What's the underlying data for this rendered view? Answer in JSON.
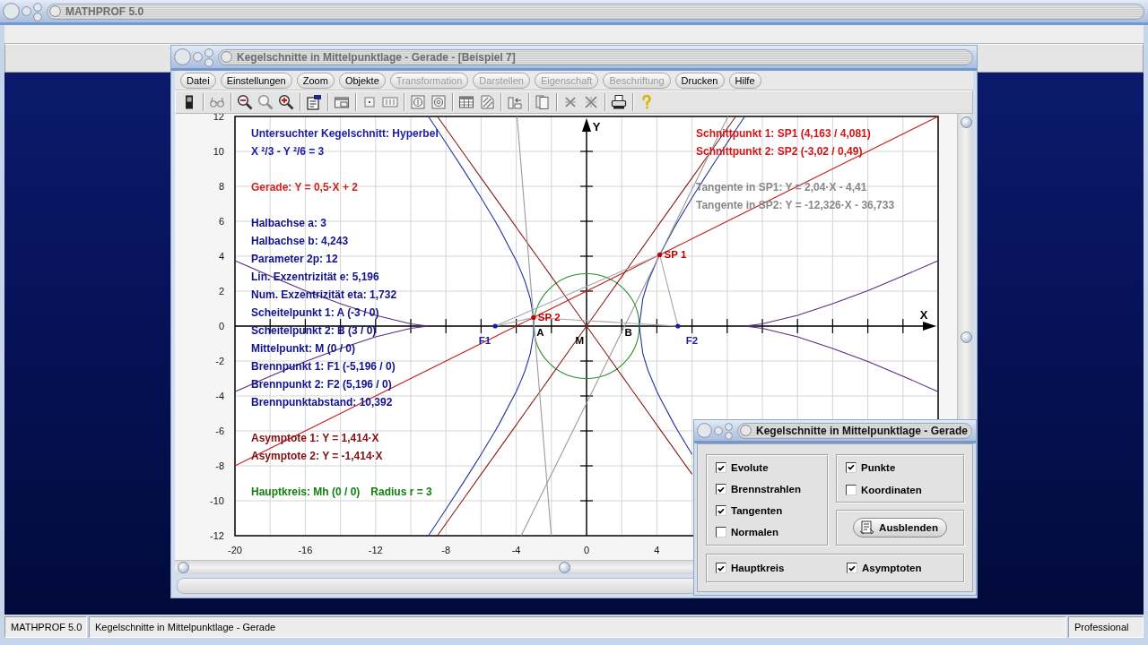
{
  "main_window": {
    "title": "MATHPROF 5.0"
  },
  "document_window": {
    "title": "Kegelschnitte in Mittelpunktlage - Gerade - [Beispiel 7]",
    "menu": [
      {
        "label": "Datei",
        "disabled": false
      },
      {
        "label": "Einstellungen",
        "disabled": false
      },
      {
        "label": "Zoom",
        "disabled": false
      },
      {
        "label": "Objekte",
        "disabled": false
      },
      {
        "label": "Transformation",
        "disabled": true
      },
      {
        "label": "Darstellen",
        "disabled": true
      },
      {
        "label": "Eigenschaft",
        "disabled": true
      },
      {
        "label": "Beschriftung",
        "disabled": true
      },
      {
        "label": "Drucken",
        "disabled": false
      },
      {
        "label": "Hilfe",
        "disabled": false
      }
    ],
    "plot": {
      "info_left": [
        {
          "kind": "column",
          "color": "#1a1aa6",
          "lines": [
            "Untersuchter Kegelschnitt: Hyperbel",
            "X ²/3 - Y ²/6 = 3"
          ]
        },
        {
          "kind": "column",
          "color": "#d42020",
          "lines": [
            "Gerade: Y = 0,5·X + 2"
          ]
        },
        {
          "kind": "column",
          "color": "#12128c",
          "lines": [
            "Halbachse a: 3",
            "Halbachse b: 4,243",
            "Parameter 2p: 12",
            "Lin. Exzentrizität e: 5,196",
            "Num. Exzentrizität eta: 1,732",
            "Scheitelpunkt 1: A (-3 / 0)",
            "Scheitelpunkt 2: B (3 / 0)",
            "Mittelpunkt: M (0 / 0)",
            "Brennpunkt 1: F1 (-5,196 / 0)",
            "Brennpunkt 2: F2 (5,196 / 0)",
            "Brennpunktabstand: 10,392"
          ]
        },
        {
          "kind": "column",
          "color": "#801010",
          "lines": [
            "Asymptote 1: Y = 1,414·X",
            "Asymptote 2: Y = -1,414·X"
          ]
        },
        {
          "kind": "row",
          "color": "#108010",
          "lines": [
            "Hauptkreis: Mh (0 / 0)",
            "Radius r = 3"
          ]
        }
      ],
      "info_right": [
        {
          "kind": "column",
          "color": "#d41414",
          "lines": [
            "Schnittpunkt 1: SP1 (4,163 / 4,081)",
            "Schnittpunkt 2: SP2 (-3,02 / 0,49)"
          ]
        },
        {
          "kind": "column",
          "color": "#888888",
          "lines": [
            "Tangente in SP1: Y = 2,04·X - 4,41",
            "Tangente in SP2: Y = -12,326·X - 36,733"
          ]
        }
      ],
      "point_styles": [
        {
          "color": "#c00000",
          "dot": true
        },
        {
          "color": "#c00000",
          "dot": true
        },
        {
          "color": "#1a1aa6",
          "dot": true
        },
        {
          "color": "#1a1aa6",
          "dot": true
        },
        {
          "color": "#000000",
          "dot": false
        },
        {
          "color": "#000000",
          "dot": false
        },
        {
          "color": "#000000",
          "dot": false
        }
      ],
      "chart_data": {
        "type": "line",
        "xlabel": "X",
        "ylabel": "Y",
        "grid": true,
        "xlim": [
          -20,
          20
        ],
        "ylim": [
          -12,
          12
        ],
        "xticks": [
          -20,
          -16,
          -12,
          -8,
          -4,
          0,
          4
        ],
        "yticks": [
          12,
          10,
          8,
          6,
          4,
          2,
          0,
          -2,
          -4,
          -6,
          -8,
          -10,
          -12
        ],
        "x": [
          -20,
          -18,
          -16,
          -14,
          -12,
          -10,
          -9,
          -8.487,
          -8,
          -7,
          -6,
          -5.196,
          -5,
          -4,
          -3.954,
          -3.721,
          -3.5,
          -3.2,
          -3.02,
          -3,
          -2.9,
          -2.6,
          -2.006,
          -1,
          0,
          1,
          2,
          2.6,
          2.9,
          3,
          3.2,
          3.5,
          4,
          4.163,
          5,
          5.196,
          6,
          7,
          8,
          8.044,
          8.487,
          9,
          10,
          12,
          14,
          16,
          18,
          20
        ],
        "series": [
          {
            "color": "#2233a0",
            "values": [
              null,
              null,
              null,
              null,
              null,
              null,
              12,
              11.23,
              10.49,
              8.94,
              7.35,
              6,
              5.66,
              3.74,
              3.64,
              3.11,
              2.55,
              1.57,
              0.49,
              0,
              null,
              null,
              null,
              null,
              null,
              null,
              null,
              null,
              null,
              0,
              1.57,
              2.55,
              3.74,
              4.08,
              5.66,
              6,
              7.35,
              8.94,
              10.49,
              10.56,
              11.23,
              12,
              null,
              null,
              null,
              null,
              null,
              null
            ]
          },
          {
            "color": "#2233a0",
            "values": [
              null,
              null,
              null,
              null,
              null,
              null,
              -12,
              -11.23,
              -10.49,
              -8.94,
              -7.35,
              -6,
              -5.66,
              -3.74,
              -3.64,
              -3.11,
              -2.55,
              -1.57,
              -0.49,
              0,
              null,
              null,
              null,
              null,
              null,
              null,
              null,
              null,
              null,
              0,
              -1.57,
              -2.55,
              -3.74,
              -4.08,
              -5.66,
              -6,
              -7.35,
              null,
              null,
              null,
              null,
              null,
              null,
              null,
              null,
              null,
              null,
              null
            ]
          },
          {
            "color": "#c41a1a",
            "values": [
              -8,
              -7,
              -6,
              -5,
              -4,
              -3,
              -2.5,
              -2.24,
              -2,
              -1.5,
              -1,
              -0.6,
              -0.5,
              0,
              0.02,
              0.14,
              0.25,
              0.4,
              0.49,
              0.5,
              0.55,
              0.7,
              1,
              1.5,
              2,
              2.5,
              3,
              3.3,
              3.45,
              3.5,
              3.6,
              3.75,
              4,
              4.08,
              4.5,
              4.6,
              5,
              5.5,
              6,
              6.02,
              6.24,
              6.5,
              7,
              8,
              9,
              10,
              11,
              12
            ]
          },
          {
            "color": "#8a1c1c",
            "values": [
              null,
              null,
              null,
              null,
              null,
              null,
              null,
              -12,
              -11.31,
              -9.9,
              -8.48,
              -7.35,
              -7.07,
              -5.66,
              -5.59,
              -5.26,
              -4.95,
              -4.52,
              -4.27,
              -4.24,
              -4.1,
              -3.68,
              -2.84,
              -1.41,
              0,
              1.41,
              2.83,
              3.68,
              4.1,
              4.24,
              4.52,
              4.95,
              5.66,
              5.89,
              7.07,
              7.35,
              8.48,
              9.9,
              11.31,
              11.37,
              12,
              null,
              null,
              null,
              null,
              null,
              null,
              null
            ]
          },
          {
            "color": "#8a1c1c",
            "values": [
              null,
              null,
              null,
              null,
              null,
              null,
              null,
              12,
              11.31,
              9.9,
              8.48,
              7.35,
              7.07,
              5.66,
              5.59,
              5.26,
              4.95,
              4.52,
              4.27,
              4.24,
              4.1,
              3.68,
              2.84,
              1.41,
              0,
              -1.41,
              -2.83,
              -3.68,
              -4.1,
              -4.24,
              -4.52,
              -4.95,
              -5.66,
              -5.89,
              -7.07,
              -7.35,
              -8.48,
              null,
              null,
              null,
              null,
              null,
              null,
              null,
              null,
              null,
              null,
              null
            ]
          },
          {
            "color": "#9a9a9a",
            "values": [
              null,
              null,
              null,
              null,
              null,
              null,
              null,
              null,
              null,
              null,
              null,
              null,
              null,
              null,
              null,
              -12,
              -11.55,
              -10.94,
              -10.57,
              -10.53,
              -10.33,
              -9.71,
              -8.5,
              -6.45,
              -4.41,
              -2.37,
              -0.33,
              0.89,
              1.51,
              1.71,
              2.12,
              2.73,
              3.75,
              4.08,
              5.79,
              6.19,
              7.83,
              9.87,
              11.91,
              12,
              null,
              null,
              null,
              null,
              null,
              null,
              null,
              null
            ]
          },
          {
            "color": "#9a9a9a",
            "values": [
              null,
              null,
              null,
              null,
              null,
              null,
              null,
              null,
              null,
              null,
              null,
              null,
              null,
              null,
              12,
              9.13,
              6.41,
              2.71,
              0.49,
              0.25,
              -0.99,
              -4.68,
              -12,
              null,
              null,
              null,
              null,
              null,
              null,
              null,
              null,
              null,
              null,
              null,
              null,
              null,
              null,
              null,
              null,
              null,
              null,
              null,
              null,
              null,
              null,
              null,
              null,
              null
            ]
          },
          {
            "color": "#5a2a82",
            "values": [
              3.75,
              2.87,
              2.03,
              1.28,
              0.62,
              0.13,
              0,
              null,
              null,
              null,
              null,
              null,
              null,
              null,
              null,
              null,
              null,
              null,
              null,
              null,
              null,
              null,
              null,
              null,
              null,
              null,
              null,
              null,
              null,
              null,
              null,
              null,
              null,
              null,
              null,
              null,
              null,
              null,
              null,
              null,
              null,
              0,
              0.13,
              0.62,
              1.28,
              2.03,
              2.87,
              3.75
            ]
          },
          {
            "color": "#5a2a82",
            "values": [
              -3.75,
              -2.87,
              -2.03,
              -1.28,
              -0.62,
              -0.13,
              0,
              null,
              null,
              null,
              null,
              null,
              null,
              null,
              null,
              null,
              null,
              null,
              null,
              null,
              null,
              null,
              null,
              null,
              null,
              null,
              null,
              null,
              null,
              null,
              null,
              null,
              null,
              null,
              null,
              null,
              null,
              null,
              null,
              null,
              null,
              0,
              -0.13,
              -0.62,
              -1.28,
              -2.03,
              -2.87,
              -3.75
            ]
          },
          {
            "color": "#a8a8a8",
            "values": [
              null,
              null,
              null,
              null,
              null,
              null,
              null,
              null,
              null,
              null,
              null,
              0,
              0.09,
              0.52,
              0.54,
              0.64,
              0.74,
              0.87,
              0.95,
              0.96,
              1,
              1.13,
              1.39,
              1.83,
              2.27,
              2.7,
              3.14,
              3.4,
              3.53,
              3.57,
              3.66,
              3.79,
              4.01,
              4.08,
              0.77,
              0,
              null,
              null,
              null,
              null,
              null,
              null,
              null,
              null,
              null,
              null,
              null,
              null
            ]
          },
          {
            "color": "#a8a8a8",
            "values": [
              null,
              null,
              null,
              null,
              null,
              null,
              null,
              null,
              null,
              null,
              null,
              0,
              0.04,
              0.27,
              0.28,
              0.33,
              0.38,
              0.45,
              0.49,
              0.49,
              0.48,
              0.46,
              0.43,
              0.37,
              0.31,
              0.25,
              0.19,
              0.15,
              0.14,
              0.13,
              0.12,
              0.1,
              0.07,
              0.06,
              0.01,
              0,
              null,
              null,
              null,
              null,
              null,
              null,
              null,
              null,
              null,
              null,
              null,
              null
            ]
          }
        ],
        "annotations": [
          {
            "text": "SP 1",
            "x": 4.163,
            "y": 4.08
          },
          {
            "text": "SP 2",
            "x": -3.02,
            "y": 0.49
          },
          {
            "text": "F1",
            "x": -5.196,
            "y": 0
          },
          {
            "text": "F2",
            "x": 5.196,
            "y": 0
          },
          {
            "text": "A",
            "x": -3,
            "y": 0
          },
          {
            "text": "B",
            "x": 3,
            "y": 0
          },
          {
            "text": "M",
            "x": 0,
            "y": 0
          }
        ]
      }
    }
  },
  "dialog": {
    "title": "Kegelschnitte in Mittelpunktlage - Gerade",
    "curve_options": [
      {
        "label": "Evolute",
        "checked": true
      },
      {
        "label": "Brennstrahlen",
        "checked": true
      },
      {
        "label": "Tangenten",
        "checked": true
      },
      {
        "label": "Normalen",
        "checked": false
      }
    ],
    "point_options": [
      {
        "label": "Punkte",
        "checked": true
      },
      {
        "label": "Koordinaten",
        "checked": false
      }
    ],
    "button": "Ausblenden",
    "extra_options": [
      {
        "label": "Hauptkreis",
        "checked": true
      },
      {
        "label": "Asymptoten",
        "checked": true
      }
    ]
  },
  "status_bar": [
    "MATHPROF 5.0",
    "Kegelschnitte in Mittelpunktlage - Gerade",
    "Professional"
  ]
}
